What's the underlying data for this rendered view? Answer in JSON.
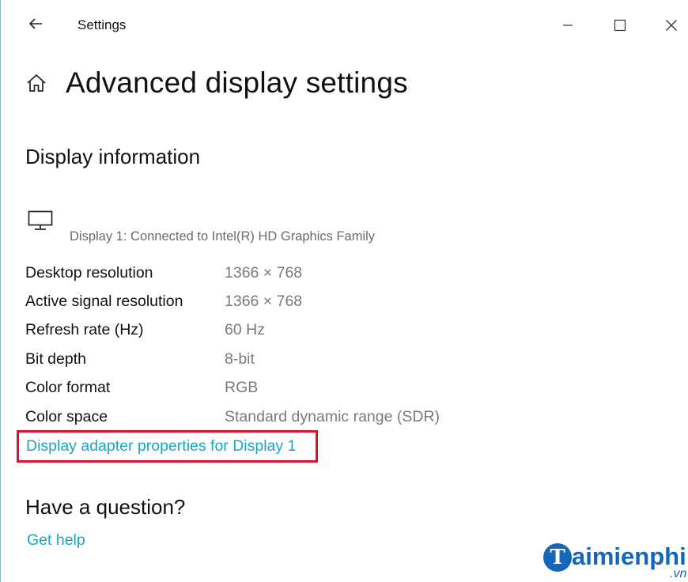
{
  "titlebar": {
    "app_title": "Settings",
    "back_icon": "back-arrow-icon",
    "minimize_icon": "minimize-icon",
    "maximize_icon": "maximize-icon",
    "close_icon": "close-icon"
  },
  "header": {
    "home_icon": "home-icon",
    "title": "Advanced display settings"
  },
  "display_info": {
    "section_title": "Display information",
    "monitor_icon": "monitor-icon",
    "display_name": "Display 1: Connected to Intel(R) HD Graphics Family",
    "rows": [
      {
        "label": "Desktop resolution",
        "value": "1366 × 768"
      },
      {
        "label": "Active signal resolution",
        "value": "1366 × 768"
      },
      {
        "label": "Refresh rate (Hz)",
        "value": "60 Hz"
      },
      {
        "label": "Bit depth",
        "value": "8-bit"
      },
      {
        "label": "Color format",
        "value": "RGB"
      },
      {
        "label": "Color space",
        "value": "Standard dynamic range (SDR)"
      }
    ],
    "adapter_link": "Display adapter properties for Display 1"
  },
  "help": {
    "section_title": "Have a question?",
    "link": "Get help"
  },
  "watermark": {
    "logo_letter": "T",
    "text": "aimienphi",
    "suffix": ".vn"
  },
  "colors": {
    "link": "#1aa5c6",
    "highlight_box": "#d7152a",
    "watermark": "#1565b8"
  }
}
